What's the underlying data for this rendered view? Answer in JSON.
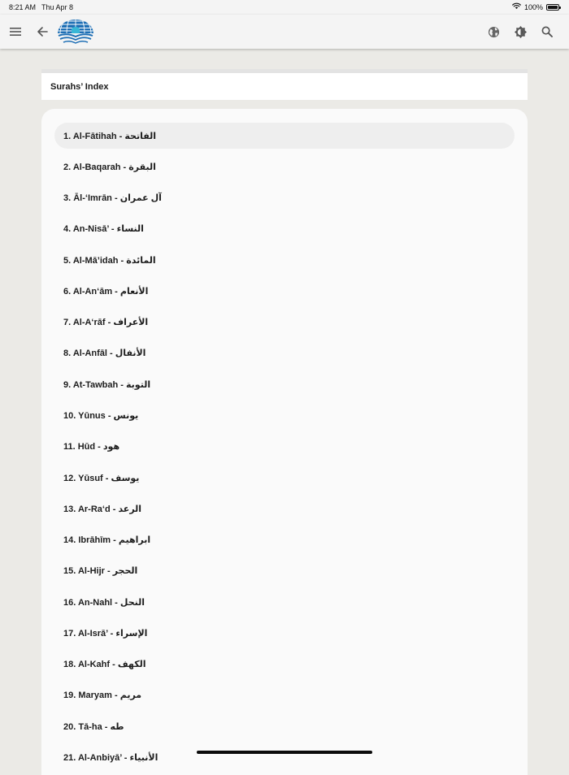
{
  "status_bar": {
    "time": "8:21 AM",
    "date": "Thu Apr 8",
    "battery": "100%",
    "icons": [
      "wifi-icon",
      "battery-icon"
    ]
  },
  "app_bar": {
    "icons": [
      "menu-icon",
      "back-arrow-icon",
      "app-logo",
      "globe-icon",
      "brightness-icon",
      "search-icon"
    ]
  },
  "index_card": {
    "title": "Surahs’ Index"
  },
  "surahs": [
    {
      "label": "1. Al-Fātihah - الفاتحة",
      "selected": true
    },
    {
      "label": "2. Al-Baqarah - البقرة"
    },
    {
      "label": "3. Āl-‘Imrān - آل عمران"
    },
    {
      "label": "4. An-Nisā’ - النساء"
    },
    {
      "label": "5. Al-Mā’idah - المائدة"
    },
    {
      "label": "6. Al-An‘ām - الأنعام"
    },
    {
      "label": "7. Al-A‘rāf - الأعراف"
    },
    {
      "label": "8. Al-Anfāl - الأنفال"
    },
    {
      "label": "9. At-Tawbah - التوبة"
    },
    {
      "label": "10. Yūnus - يونس"
    },
    {
      "label": "11. Hūd - هود"
    },
    {
      "label": "12. Yūsuf - يوسف"
    },
    {
      "label": "13. Ar-Ra‘d - الرعد"
    },
    {
      "label": "14. Ibrāhīm - ابراهيم"
    },
    {
      "label": "15. Al-Hijr - الحجر"
    },
    {
      "label": "16. An-Nahl - النحل"
    },
    {
      "label": "17. Al-Isrā’ - الإسراء"
    },
    {
      "label": "18. Al-Kahf - الكهف"
    },
    {
      "label": "19. Maryam - مريم"
    },
    {
      "label": "20. Tā-ha - طه"
    },
    {
      "label": "21. Al-Anbiyā’ - الأنبياء"
    }
  ],
  "colors": {
    "background": "#ebeae6",
    "app_bar": "#f4f4f4",
    "list_card": "#fafafa",
    "selected_item": "#eeeeee",
    "logo_blue": "#1e6fb5"
  }
}
